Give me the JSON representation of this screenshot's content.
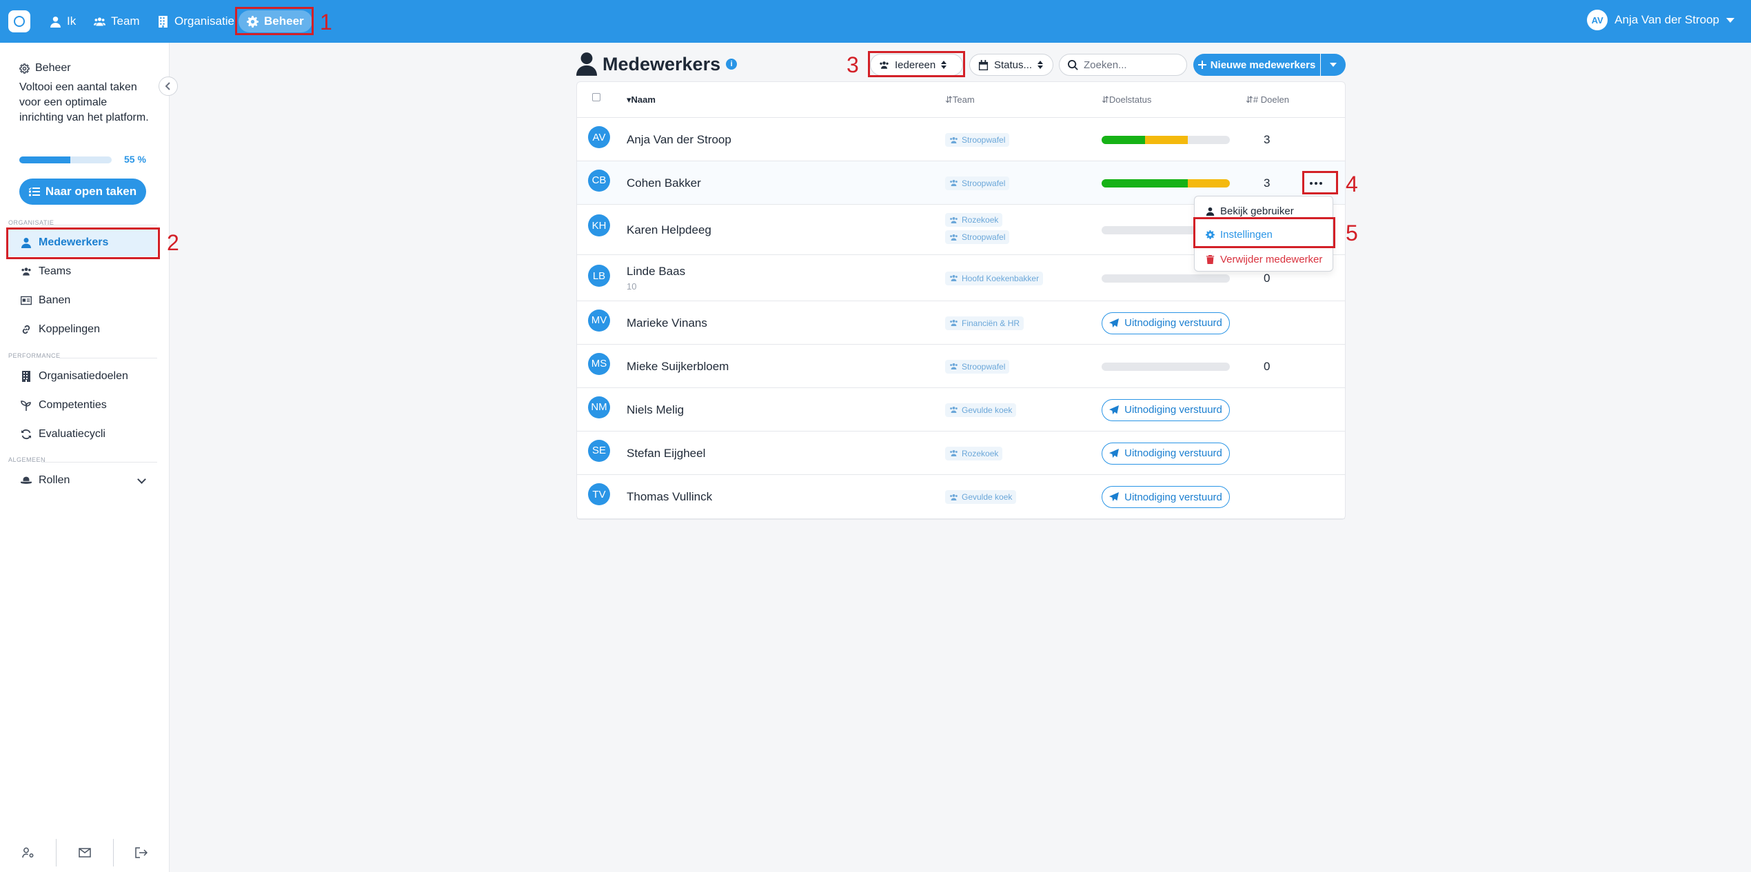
{
  "topbar": {
    "nav": [
      {
        "label": "Ik",
        "icon": "person-icon"
      },
      {
        "label": "Team",
        "icon": "users-icon"
      },
      {
        "label": "Organisatie",
        "icon": "building-icon"
      },
      {
        "label": "Beheer",
        "icon": "gear-icon",
        "active": true
      }
    ],
    "user": {
      "initials": "AV",
      "name": "Anja Van der Stroop"
    }
  },
  "sidebar": {
    "title": "Beheer",
    "description": "Voltooi een aantal taken voor een optimale inrichting van het platform.",
    "progress": {
      "percent": 55,
      "label": "55 %"
    },
    "open_tasks_label": "Naar open taken",
    "sections": {
      "organisatie": "ORGANISATIE",
      "performance": "PERFORMANCE",
      "algemeen": "ALGEMEEN"
    },
    "items": [
      {
        "label": "Medewerkers",
        "active": true
      },
      {
        "label": "Teams"
      },
      {
        "label": "Banen"
      },
      {
        "label": "Koppelingen"
      },
      {
        "label": "Organisatiedoelen"
      },
      {
        "label": "Competenties"
      },
      {
        "label": "Evaluatiecycli"
      },
      {
        "label": "Rollen"
      }
    ]
  },
  "main": {
    "title": "Medewerkers",
    "filters": {
      "audience": "Iedereen",
      "status": "Status..."
    },
    "search": {
      "placeholder": "Zoeken...",
      "value": ""
    },
    "new_button_label": "Nieuwe medewerkers",
    "table": {
      "columns": [
        "Naam",
        "Team",
        "Doelstatus",
        "# Doelen"
      ],
      "rows": [
        {
          "initials": "AV",
          "name": "Anja Van der Stroop",
          "sub": "",
          "teams": [
            "Stroopwafel"
          ],
          "status": {
            "green": 0.34,
            "yellow": 0.33
          },
          "goals": "3"
        },
        {
          "initials": "CB",
          "name": "Cohen Bakker",
          "sub": "",
          "teams": [
            "Stroopwafel"
          ],
          "status": {
            "green": 0.67,
            "yellow": 0.33
          },
          "goals": "3"
        },
        {
          "initials": "KH",
          "name": "Karen Helpdeeg",
          "sub": "",
          "teams": [
            "Rozekoek",
            "Stroopwafel"
          ],
          "status": {
            "green": 0,
            "yellow": 0
          },
          "goals": ""
        },
        {
          "initials": "LB",
          "name": "Linde Baas",
          "sub": "10",
          "teams": [
            "Hoofd Koekenbakker"
          ],
          "status": {
            "green": 0,
            "yellow": 0
          },
          "goals": "0"
        },
        {
          "initials": "MV",
          "name": "Marieke Vinans",
          "sub": "",
          "teams": [
            "Financiën & HR"
          ],
          "invite": "Uitnodiging verstuurd",
          "goals": ""
        },
        {
          "initials": "MS",
          "name": "Mieke Suijkerbloem",
          "sub": "",
          "teams": [
            "Stroopwafel"
          ],
          "status": {
            "green": 0,
            "yellow": 0
          },
          "goals": "0"
        },
        {
          "initials": "NM",
          "name": "Niels Melig",
          "sub": "",
          "teams": [
            "Gevulde koek"
          ],
          "invite": "Uitnodiging verstuurd",
          "goals": ""
        },
        {
          "initials": "SE",
          "name": "Stefan Eijgheel",
          "sub": "",
          "teams": [
            "Rozekoek"
          ],
          "invite": "Uitnodiging verstuurd",
          "goals": ""
        },
        {
          "initials": "TV",
          "name": "Thomas Vullinck",
          "sub": "",
          "teams": [
            "Gevulde koek"
          ],
          "invite": "Uitnodiging verstuurd",
          "goals": ""
        }
      ]
    },
    "row_menu": {
      "items": [
        {
          "label": "Bekijk gebruiker",
          "color": "#1f2937"
        },
        {
          "label": "Instellingen",
          "color": "#2a95e6"
        },
        {
          "label": "Verwijder medewerker",
          "color": "#d9333f"
        }
      ]
    }
  },
  "annotations": [
    "1",
    "2",
    "3",
    "4",
    "5"
  ],
  "colors": {
    "brand": "#2a95e6",
    "annotation": "#d32027",
    "danger": "#d9333f"
  }
}
